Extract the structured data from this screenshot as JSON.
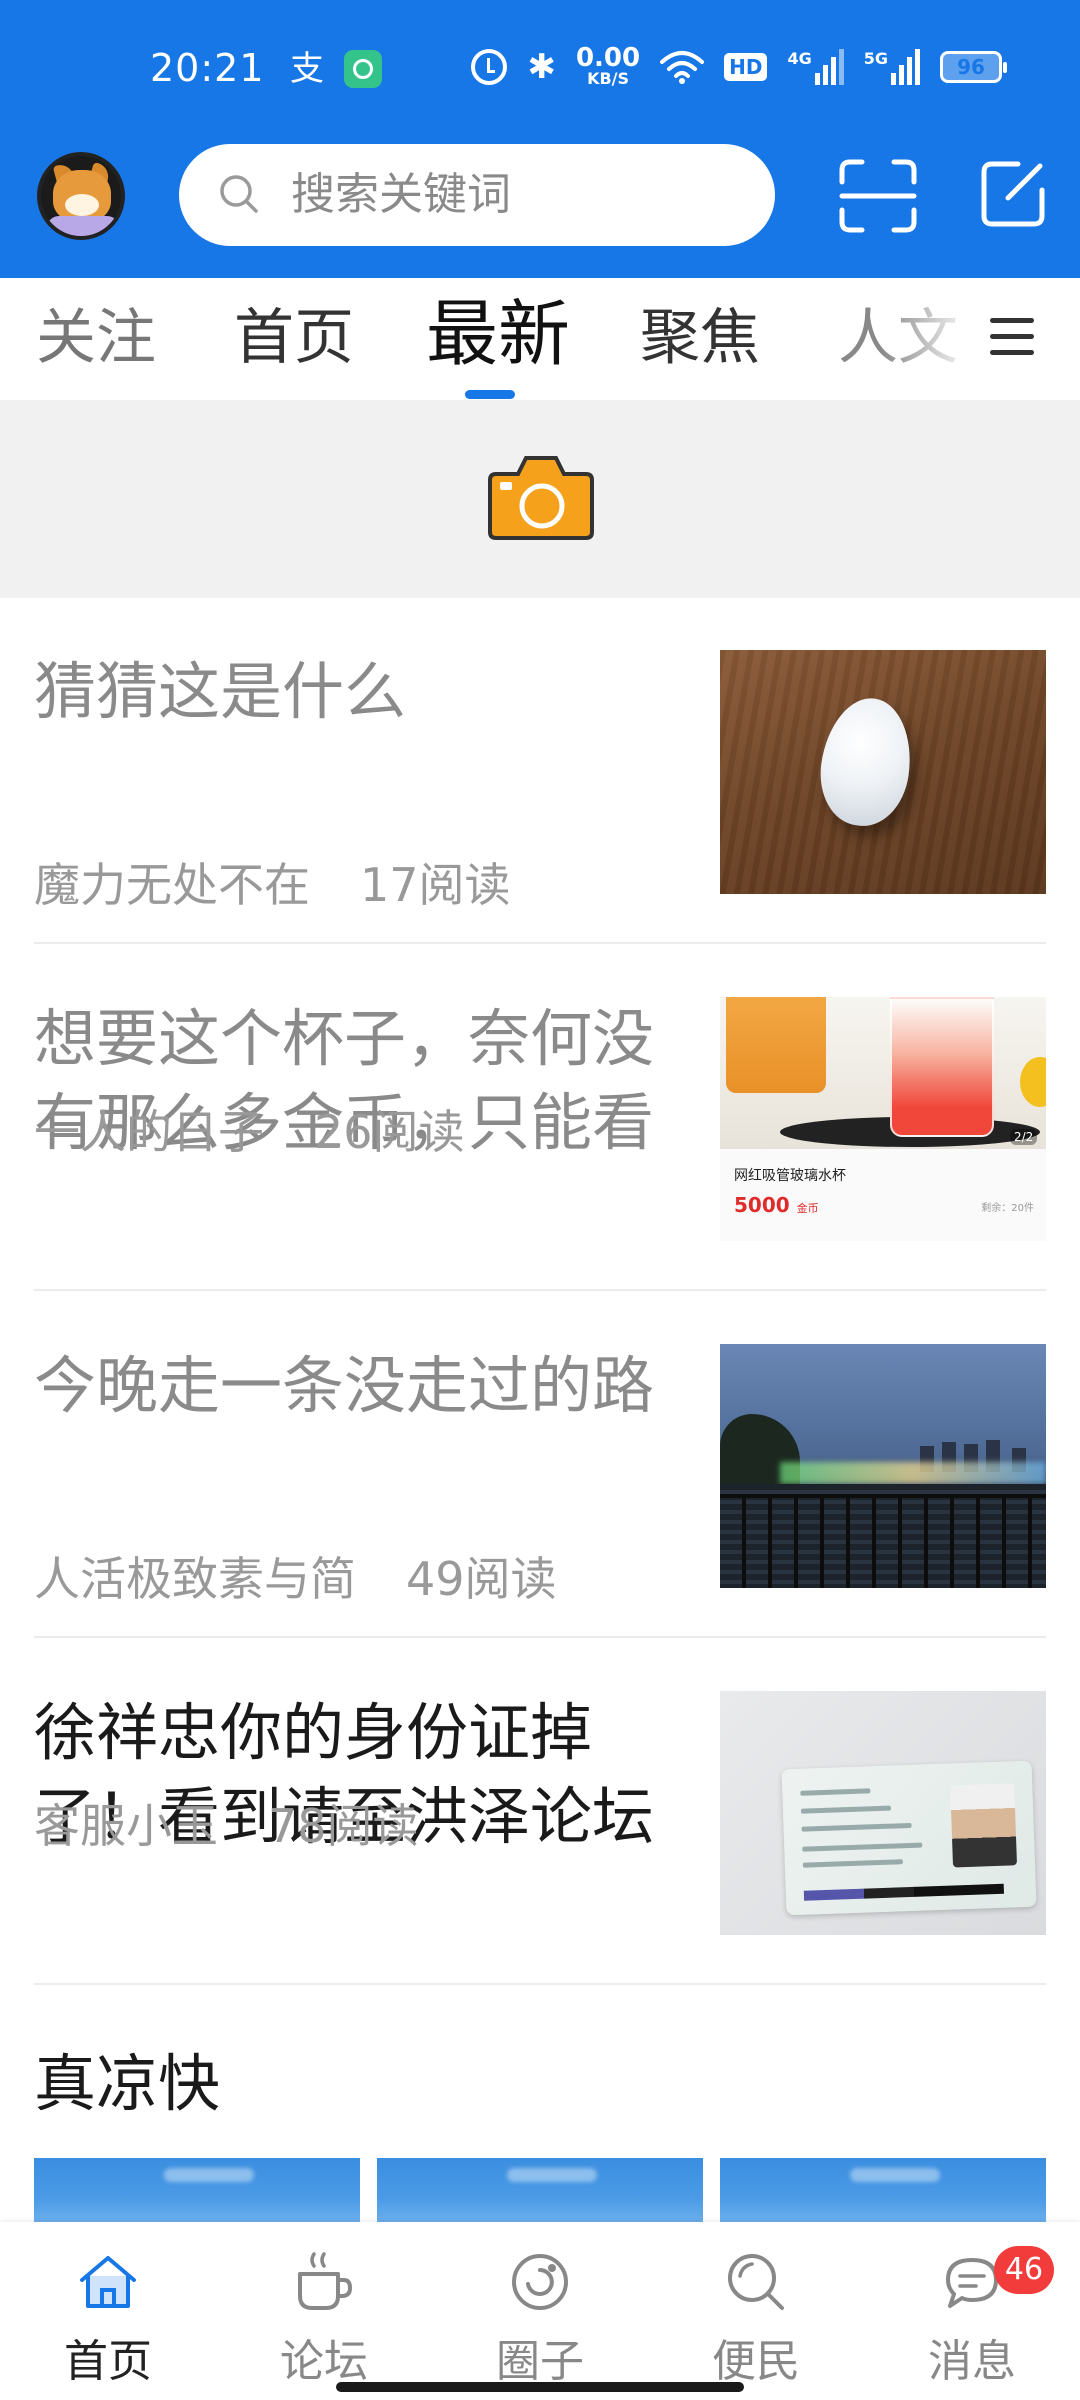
{
  "status_bar": {
    "time": "20:21",
    "app_icon_1": "支",
    "net_speed": "0.00",
    "net_speed_unit": "KB/S",
    "hd": "HD",
    "net1": "4G",
    "net2": "5G",
    "battery": "96"
  },
  "header": {
    "search_placeholder": "搜索关键词",
    "accent_color": "#1877e6"
  },
  "tabs": [
    {
      "label": "关注"
    },
    {
      "label": "首页"
    },
    {
      "label": "最新",
      "active": true
    },
    {
      "label": "聚焦"
    },
    {
      "label": "人文"
    }
  ],
  "feed": [
    {
      "title": "猜猜这是什么",
      "author": "魔力无处不在",
      "reads": "17阅读",
      "thumb": "egg"
    },
    {
      "title": "想要这个杯子，奈何没有那么多金币，只能看",
      "author": "一人的日子",
      "reads": "26阅读",
      "thumb": "cup",
      "thumb_text": {
        "pager": "2/2",
        "product": "网红吸管玻璃水杯",
        "price": "5000",
        "price_unit": "金币",
        "stock": "剩余：20件"
      }
    },
    {
      "title": "今晚走一条没走过的路",
      "author": "人活极致素与简",
      "reads": "49阅读",
      "thumb": "night"
    },
    {
      "title": "徐祥忠你的身份证掉了！看到请至洪泽论坛",
      "author": "客服小玉",
      "reads": "78阅读",
      "thumb": "idcard"
    }
  ],
  "section": {
    "title": "真凉快"
  },
  "bottom_nav": [
    {
      "label": "首页",
      "icon": "home-icon",
      "active": true
    },
    {
      "label": "论坛",
      "icon": "coffee-cup-icon"
    },
    {
      "label": "圈子",
      "icon": "circle-icon"
    },
    {
      "label": "便民",
      "icon": "search-icon"
    },
    {
      "label": "消息",
      "icon": "message-icon",
      "badge": "46"
    }
  ]
}
